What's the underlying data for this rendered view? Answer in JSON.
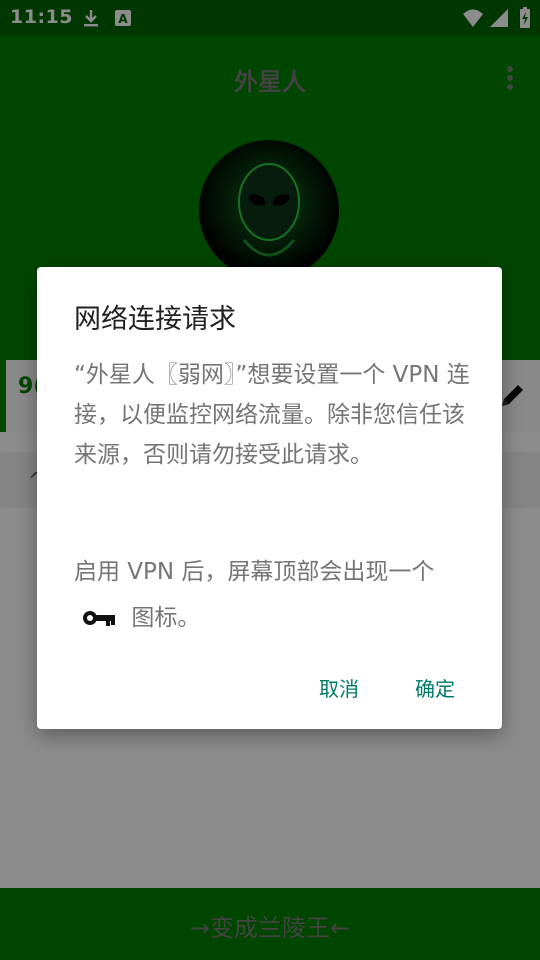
{
  "status_bar": {
    "time": "11:15",
    "icons": [
      "download-icon",
      "a-badge-icon",
      "wifi-icon",
      "signal-icon",
      "battery-charging-icon"
    ]
  },
  "app_bar": {
    "title": "外星人",
    "menu_icon": "more-vert-icon"
  },
  "header": {
    "avatar_icon": "alien-avatar"
  },
  "main": {
    "row_value_partial": "9(",
    "edit_icon": "pencil-icon",
    "row2_glyph": "^"
  },
  "bottom_bar": {
    "label": "→变成兰陵王←"
  },
  "dialog": {
    "title": "网络连接请求",
    "message": "“外星人〖弱网〗”想要设置一个 VPN 连接，以便监控网络流量。除非您信任该来源，否则请勿接受此请求。",
    "footer_before_icon": "启用 VPN 后，屏幕顶部会出现一个",
    "footer_after_icon": "图标。",
    "key_icon": "key-icon",
    "cancel_label": "取消",
    "ok_label": "确定"
  },
  "colors": {
    "primary": "#008000",
    "status_bar": "#006400",
    "dialog_button": "#00796b"
  }
}
